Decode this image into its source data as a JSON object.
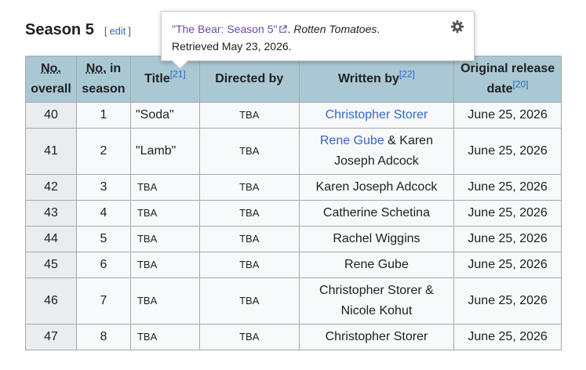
{
  "section": {
    "title": "Season 5",
    "edit_open": "[",
    "edit_label": "edit",
    "edit_close": "]"
  },
  "popup": {
    "link_text": "\"The Bear: Season 5\"",
    "after_link": ". ",
    "publisher": "Rotten Tomatoes",
    "after_publisher": ".",
    "retrieved": "Retrieved May 23, 2026.",
    "settings_icon": "gear-icon",
    "external_icon": "external-link-icon"
  },
  "table": {
    "headers": {
      "overall_abbr": "No.",
      "overall_rest": "overall",
      "season_abbr": "No.",
      "season_rest": " in season",
      "title": "Title",
      "title_ref": "[21]",
      "directed": "Directed by",
      "written": "Written by",
      "written_ref": "[22]",
      "release": "Original release date",
      "release_ref": "[20]"
    },
    "rows": [
      {
        "overall": "40",
        "season": "1",
        "title": "\"Soda\"",
        "directed": "TBA",
        "writer1": "Christopher Storer",
        "writer_sep": "",
        "writer2": "",
        "date": "June 25, 2026"
      },
      {
        "overall": "41",
        "season": "2",
        "title": "\"Lamb\"",
        "directed": "TBA",
        "writer1": "Rene Gube",
        "writer_sep": " & Karen Joseph Adcock",
        "writer2": "",
        "date": "June 25, 2026"
      },
      {
        "overall": "42",
        "season": "3",
        "title": "TBA",
        "directed": "TBA",
        "writer1": "",
        "writer_sep": "Karen Joseph Adcock",
        "writer2": "",
        "date": "June 25, 2026"
      },
      {
        "overall": "43",
        "season": "4",
        "title": "TBA",
        "directed": "TBA",
        "writer1": "",
        "writer_sep": "Catherine Schetina",
        "writer2": "",
        "date": "June 25, 2026"
      },
      {
        "overall": "44",
        "season": "5",
        "title": "TBA",
        "directed": "TBA",
        "writer1": "",
        "writer_sep": "Rachel Wiggins",
        "writer2": "",
        "date": "June 25, 2026"
      },
      {
        "overall": "45",
        "season": "6",
        "title": "TBA",
        "directed": "TBA",
        "writer1": "",
        "writer_sep": "Rene Gube",
        "writer2": "",
        "date": "June 25, 2026"
      },
      {
        "overall": "46",
        "season": "7",
        "title": "TBA",
        "directed": "TBA",
        "writer1": "",
        "writer_sep": "Christopher Storer & Nicole Kohut",
        "writer2": "",
        "date": "June 25, 2026"
      },
      {
        "overall": "47",
        "season": "8",
        "title": "TBA",
        "directed": "TBA",
        "writer1": "",
        "writer_sep": "Christopher Storer",
        "writer2": "",
        "date": "June 25, 2026"
      }
    ]
  },
  "colors": {
    "header_bg": "#a9c8d3",
    "link": "#3366cc",
    "visited_link": "#6b4ba1",
    "border": "#a2a9b1"
  }
}
